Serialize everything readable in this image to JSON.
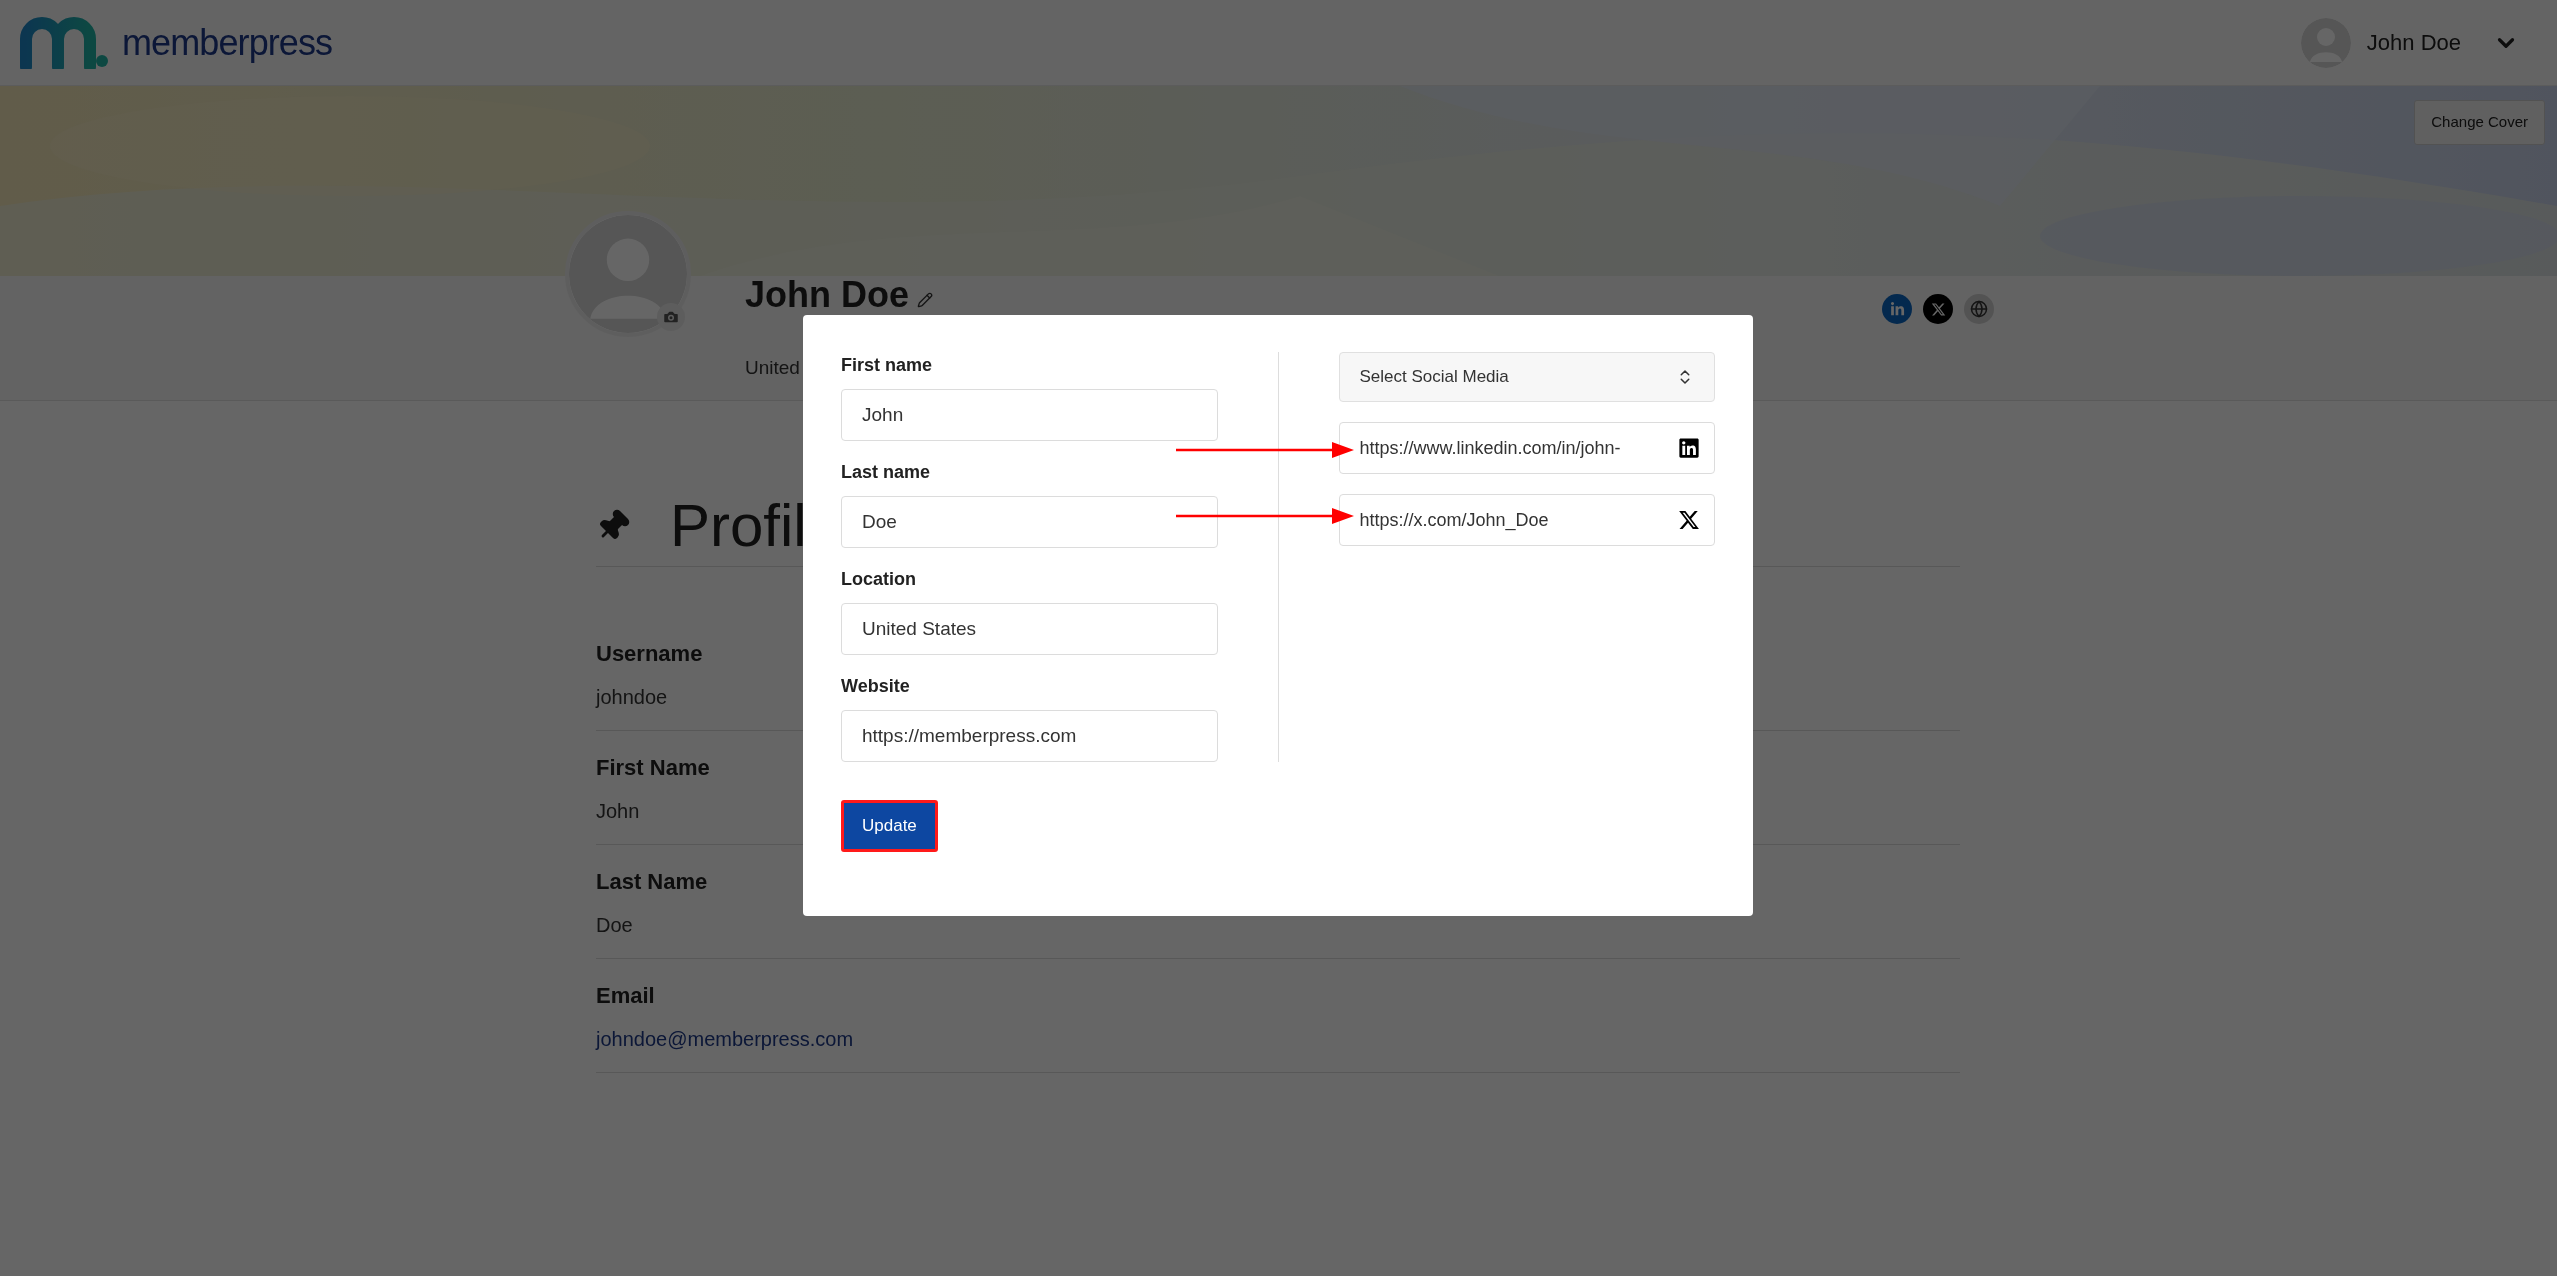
{
  "header": {
    "logo_text": "memberpress",
    "user_name": "John Doe"
  },
  "cover": {
    "change_cover_button": "Change Cover"
  },
  "profile": {
    "name": "John Doe",
    "location": "United"
  },
  "social_icons": [
    {
      "kind": "linkedin"
    },
    {
      "kind": "x"
    },
    {
      "kind": "website"
    }
  ],
  "section": {
    "title": "Profil"
  },
  "details": [
    {
      "label": "Username",
      "value": "johndoe",
      "kind": "text"
    },
    {
      "label": "First Name",
      "value": "John",
      "kind": "text"
    },
    {
      "label": "Last Name",
      "value": "Doe",
      "kind": "text"
    },
    {
      "label": "Email",
      "value": "johndoe@memberpress.com",
      "kind": "link"
    }
  ],
  "modal": {
    "fields": [
      {
        "label": "First name",
        "value": "John"
      },
      {
        "label": "Last name",
        "value": "Doe"
      },
      {
        "label": "Location",
        "value": "United States"
      },
      {
        "label": "Website",
        "value": "https://memberpress.com"
      }
    ],
    "social_select": "Select Social Media",
    "social_links": [
      {
        "kind": "linkedin",
        "value": "https://www.linkedin.com/in/john-"
      },
      {
        "kind": "x",
        "value": "https://x.com/John_Doe"
      }
    ],
    "button": "Update"
  }
}
